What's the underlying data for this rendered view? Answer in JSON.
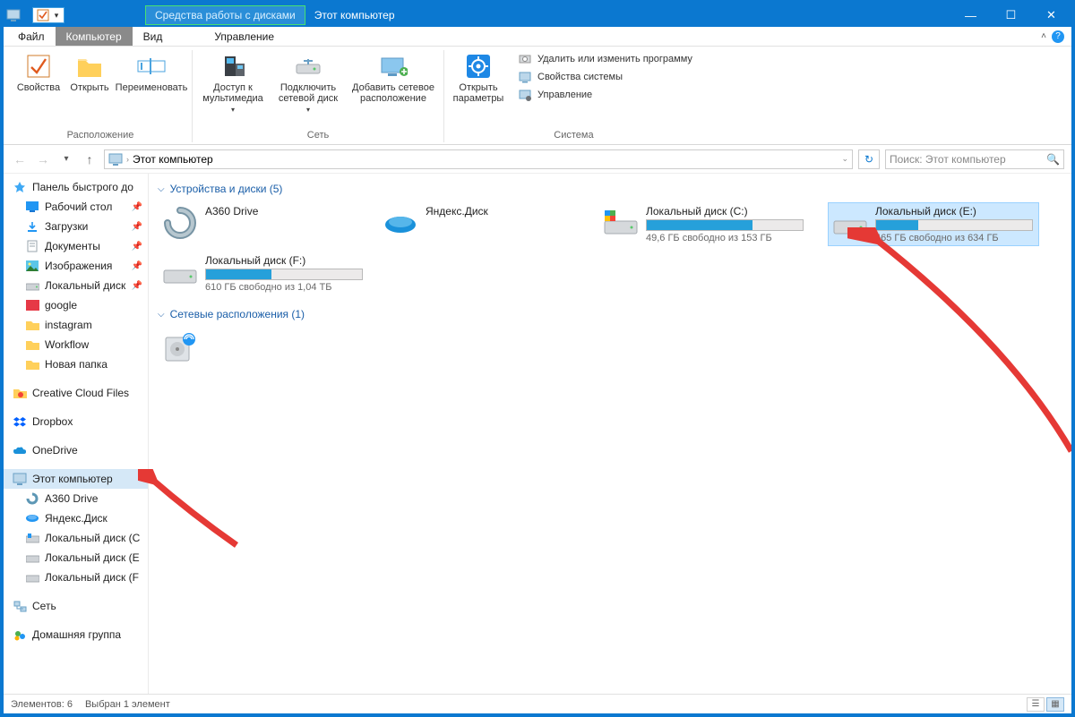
{
  "titlebar": {
    "context_tab": "Средства работы с дисками",
    "title": "Этот компьютер"
  },
  "tabs": {
    "file": "Файл",
    "computer": "Компьютер",
    "view": "Вид",
    "manage": "Управление"
  },
  "ribbon": {
    "location_group": "Расположение",
    "properties": "Свойства",
    "open": "Открыть",
    "rename": "Переименовать",
    "network_group": "Сеть",
    "media_access": "Доступ к мультимедиа",
    "map_drive": "Подключить сетевой диск",
    "add_net_location": "Добавить сетевое расположение",
    "system_group": "Система",
    "open_settings": "Открыть параметры",
    "uninstall": "Удалить или изменить программу",
    "sys_properties": "Свойства системы",
    "manage": "Управление"
  },
  "addressbar": {
    "location": "Этот компьютер",
    "search_placeholder": "Поиск: Этот компьютер"
  },
  "sidebar": {
    "quick_access": "Панель быстрого до",
    "desktop": "Рабочий стол",
    "downloads": "Загрузки",
    "documents": "Документы",
    "pictures": "Изображения",
    "local_disk_short": "Локальный диск",
    "google": "google",
    "instagram": "instagram",
    "workflow": "Workflow",
    "new_folder": "Новая папка",
    "creative_cloud": "Creative Cloud Files",
    "dropbox": "Dropbox",
    "onedrive": "OneDrive",
    "this_pc": "Этот компьютер",
    "a360": "A360 Drive",
    "yandex": "Яндекс.Диск",
    "disk_c": "Локальный диск (C",
    "disk_e": "Локальный диск (E",
    "disk_f": "Локальный диск (F",
    "network": "Сеть",
    "homegroup": "Домашняя группа"
  },
  "content": {
    "devices_header": "Устройства и диски (5)",
    "network_header": "Сетевые расположения (1)",
    "a360": "A360 Drive",
    "yandex": "Яндекс.Диск",
    "disk_c": {
      "name": "Локальный диск (C:)",
      "detail": "49,6 ГБ свободно из 153 ГБ",
      "fill": 68
    },
    "disk_e": {
      "name": "Локальный диск (E:)",
      "detail": "465 ГБ свободно из 634 ГБ",
      "fill": 27
    },
    "disk_f": {
      "name": "Локальный диск (F:)",
      "detail": "610 ГБ свободно из 1,04 ТБ",
      "fill": 42
    }
  },
  "status": {
    "count": "Элементов: 6",
    "selection": "Выбран 1 элемент"
  }
}
